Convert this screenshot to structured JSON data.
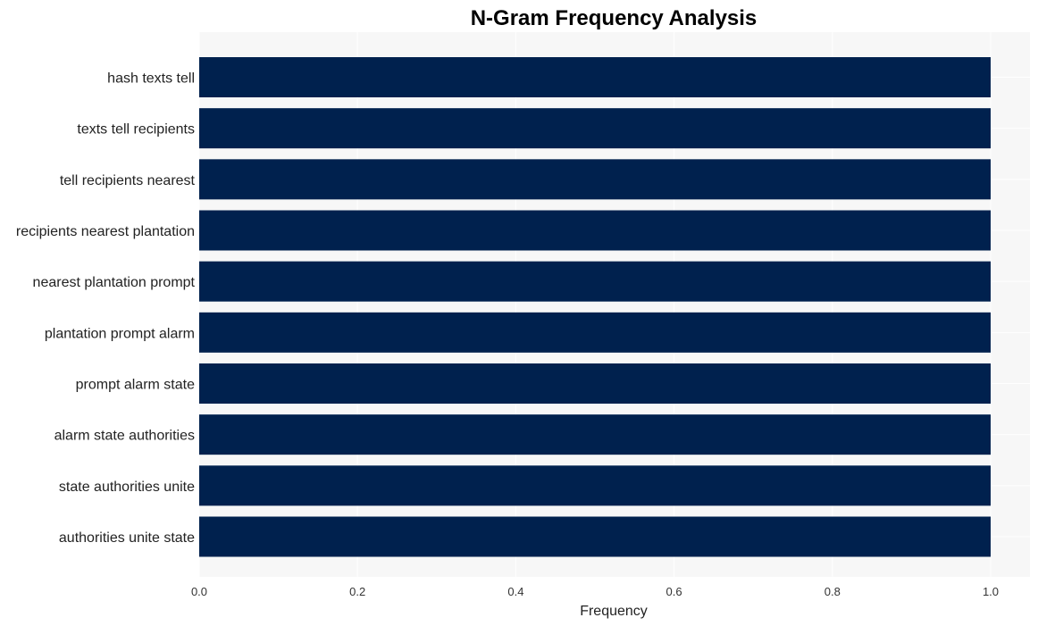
{
  "chart_data": {
    "type": "bar",
    "orientation": "horizontal",
    "title": "N-Gram Frequency Analysis",
    "xlabel": "Frequency",
    "ylabel": "",
    "categories": [
      "hash texts tell",
      "texts tell recipients",
      "tell recipients nearest",
      "recipients nearest plantation",
      "nearest plantation prompt",
      "plantation prompt alarm",
      "prompt alarm state",
      "alarm state authorities",
      "state authorities unite",
      "authorities unite state"
    ],
    "values": [
      1,
      1,
      1,
      1,
      1,
      1,
      1,
      1,
      1,
      1
    ],
    "xlim": [
      0,
      1.05
    ],
    "xticks": [
      0.0,
      0.2,
      0.4,
      0.6,
      0.8,
      1.0
    ],
    "xtick_labels": [
      "0.0",
      "0.2",
      "0.4",
      "0.6",
      "0.8",
      "1.0"
    ],
    "grid": true,
    "legend": "none",
    "colors": {
      "bar": "#00214e",
      "plot_background": "#f7f7f7",
      "grid": "#ffffff"
    }
  }
}
